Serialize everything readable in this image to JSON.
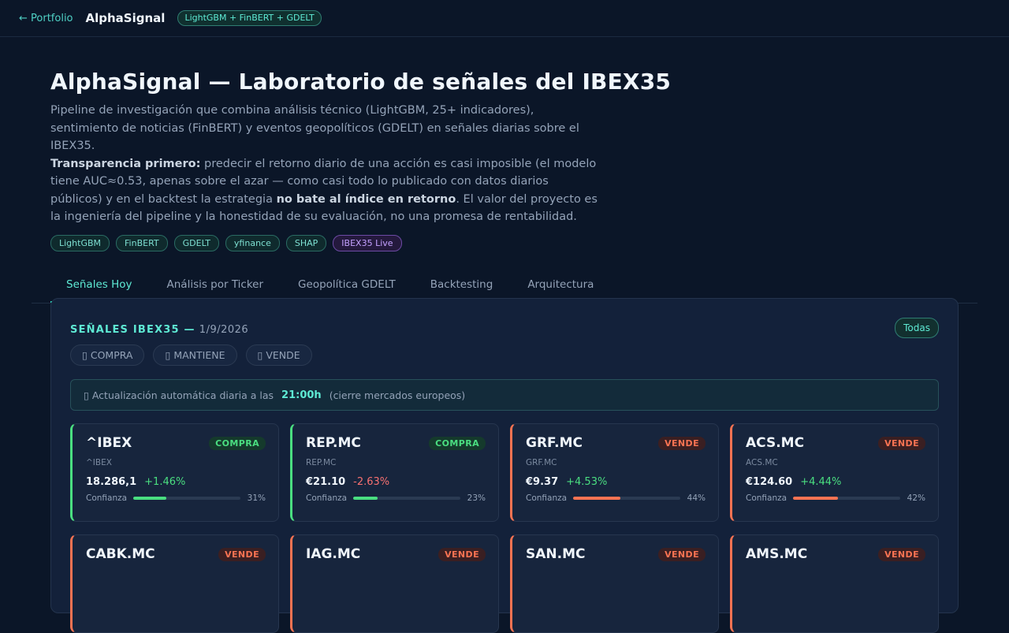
{
  "topbar": {
    "back_label": "← Portfolio",
    "brand": "AlphaSignal",
    "stack_pill": "LightGBM + FinBERT + GDELT"
  },
  "hero": {
    "title": "AlphaSignal — Laboratorio de señales del IBEX35",
    "desc_1": "Pipeline de investigación que combina análisis técnico (LightGBM, 25+ indicadores), sentimiento de noticias (FinBERT) y eventos geopolíticos (GDELT) en señales diarias sobre el IBEX35.",
    "desc_bold_1": "Transparencia primero:",
    "desc_2": " predecir el retorno diario de una acción es casi imposible (el modelo tiene AUC≈0.53, apenas sobre el azar — como casi todo lo publicado con datos diarios públicos) y en el backtest la estrategia ",
    "desc_bold_2": "no bate al índice en retorno",
    "desc_3": ". El valor del proyecto es la ingeniería del pipeline y la honestidad de su evaluación, no una promesa de rentabilidad.",
    "tags": [
      "LightGBM",
      "FinBERT",
      "GDELT",
      "yfinance",
      "SHAP",
      "IBEX35 Live"
    ]
  },
  "tabs": [
    "Señales Hoy",
    "Análisis por Ticker",
    "Geopolítica GDELT",
    "Backtesting",
    "Arquitectura"
  ],
  "panel": {
    "title": "SEÑALES IBEX35 —",
    "date": "1/9/2026",
    "todas_label": "Todas",
    "filters": [
      "▯ COMPRA",
      "▯ MANTIENE",
      "▯ VENDE"
    ],
    "notice_prefix": "▯ Actualización automática diaria a las",
    "notice_time": "21:00h",
    "notice_suffix": "(cierre mercados europeos)",
    "conf_label": "Confianza"
  },
  "cards": [
    {
      "ticker": "^IBEX",
      "sub": "^IBEX",
      "signal": "COMPRA",
      "price": "18.286,1",
      "change": "+1.46%",
      "dir": "up",
      "confidence": 31,
      "conf_text": "31%"
    },
    {
      "ticker": "REP.MC",
      "sub": "REP.MC",
      "signal": "COMPRA",
      "price": "€21.10",
      "change": "-2.63%",
      "dir": "down",
      "confidence": 23,
      "conf_text": "23%"
    },
    {
      "ticker": "GRF.MC",
      "sub": "GRF.MC",
      "signal": "VENDE",
      "price": "€9.37",
      "change": "+4.53%",
      "dir": "up",
      "confidence": 44,
      "conf_text": "44%"
    },
    {
      "ticker": "ACS.MC",
      "sub": "ACS.MC",
      "signal": "VENDE",
      "price": "€124.60",
      "change": "+4.44%",
      "dir": "up",
      "confidence": 42,
      "conf_text": "42%"
    },
    {
      "ticker": "CABK.MC",
      "signal": "VENDE"
    },
    {
      "ticker": "IAG.MC",
      "signal": "VENDE"
    },
    {
      "ticker": "SAN.MC",
      "signal": "VENDE"
    },
    {
      "ticker": "AMS.MC",
      "signal": "VENDE"
    }
  ],
  "colors": {
    "accent": "#5eead4",
    "buy": "#4ade80",
    "sell": "#f97352",
    "negative": "#f87171",
    "background": "#0b1628"
  }
}
